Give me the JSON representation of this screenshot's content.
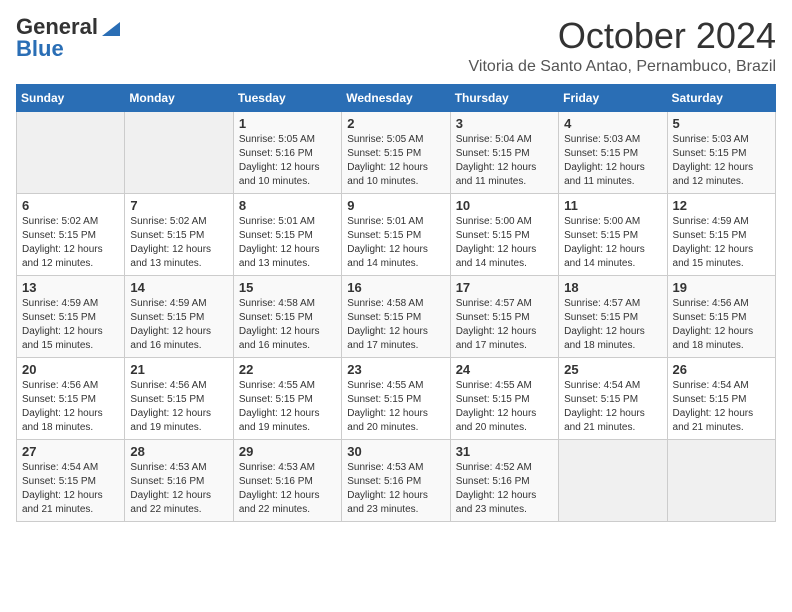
{
  "header": {
    "logo_general": "General",
    "logo_blue": "Blue",
    "month": "October 2024",
    "location": "Vitoria de Santo Antao, Pernambuco, Brazil"
  },
  "weekdays": [
    "Sunday",
    "Monday",
    "Tuesday",
    "Wednesday",
    "Thursday",
    "Friday",
    "Saturday"
  ],
  "weeks": [
    [
      {
        "day": null
      },
      {
        "day": null
      },
      {
        "day": "1",
        "sunrise": "5:05 AM",
        "sunset": "5:16 PM",
        "daylight": "12 hours and 10 minutes."
      },
      {
        "day": "2",
        "sunrise": "5:05 AM",
        "sunset": "5:15 PM",
        "daylight": "12 hours and 10 minutes."
      },
      {
        "day": "3",
        "sunrise": "5:04 AM",
        "sunset": "5:15 PM",
        "daylight": "12 hours and 11 minutes."
      },
      {
        "day": "4",
        "sunrise": "5:03 AM",
        "sunset": "5:15 PM",
        "daylight": "12 hours and 11 minutes."
      },
      {
        "day": "5",
        "sunrise": "5:03 AM",
        "sunset": "5:15 PM",
        "daylight": "12 hours and 12 minutes."
      }
    ],
    [
      {
        "day": "6",
        "sunrise": "5:02 AM",
        "sunset": "5:15 PM",
        "daylight": "12 hours and 12 minutes."
      },
      {
        "day": "7",
        "sunrise": "5:02 AM",
        "sunset": "5:15 PM",
        "daylight": "12 hours and 13 minutes."
      },
      {
        "day": "8",
        "sunrise": "5:01 AM",
        "sunset": "5:15 PM",
        "daylight": "12 hours and 13 minutes."
      },
      {
        "day": "9",
        "sunrise": "5:01 AM",
        "sunset": "5:15 PM",
        "daylight": "12 hours and 14 minutes."
      },
      {
        "day": "10",
        "sunrise": "5:00 AM",
        "sunset": "5:15 PM",
        "daylight": "12 hours and 14 minutes."
      },
      {
        "day": "11",
        "sunrise": "5:00 AM",
        "sunset": "5:15 PM",
        "daylight": "12 hours and 14 minutes."
      },
      {
        "day": "12",
        "sunrise": "4:59 AM",
        "sunset": "5:15 PM",
        "daylight": "12 hours and 15 minutes."
      }
    ],
    [
      {
        "day": "13",
        "sunrise": "4:59 AM",
        "sunset": "5:15 PM",
        "daylight": "12 hours and 15 minutes."
      },
      {
        "day": "14",
        "sunrise": "4:59 AM",
        "sunset": "5:15 PM",
        "daylight": "12 hours and 16 minutes."
      },
      {
        "day": "15",
        "sunrise": "4:58 AM",
        "sunset": "5:15 PM",
        "daylight": "12 hours and 16 minutes."
      },
      {
        "day": "16",
        "sunrise": "4:58 AM",
        "sunset": "5:15 PM",
        "daylight": "12 hours and 17 minutes."
      },
      {
        "day": "17",
        "sunrise": "4:57 AM",
        "sunset": "5:15 PM",
        "daylight": "12 hours and 17 minutes."
      },
      {
        "day": "18",
        "sunrise": "4:57 AM",
        "sunset": "5:15 PM",
        "daylight": "12 hours and 18 minutes."
      },
      {
        "day": "19",
        "sunrise": "4:56 AM",
        "sunset": "5:15 PM",
        "daylight": "12 hours and 18 minutes."
      }
    ],
    [
      {
        "day": "20",
        "sunrise": "4:56 AM",
        "sunset": "5:15 PM",
        "daylight": "12 hours and 18 minutes."
      },
      {
        "day": "21",
        "sunrise": "4:56 AM",
        "sunset": "5:15 PM",
        "daylight": "12 hours and 19 minutes."
      },
      {
        "day": "22",
        "sunrise": "4:55 AM",
        "sunset": "5:15 PM",
        "daylight": "12 hours and 19 minutes."
      },
      {
        "day": "23",
        "sunrise": "4:55 AM",
        "sunset": "5:15 PM",
        "daylight": "12 hours and 20 minutes."
      },
      {
        "day": "24",
        "sunrise": "4:55 AM",
        "sunset": "5:15 PM",
        "daylight": "12 hours and 20 minutes."
      },
      {
        "day": "25",
        "sunrise": "4:54 AM",
        "sunset": "5:15 PM",
        "daylight": "12 hours and 21 minutes."
      },
      {
        "day": "26",
        "sunrise": "4:54 AM",
        "sunset": "5:15 PM",
        "daylight": "12 hours and 21 minutes."
      }
    ],
    [
      {
        "day": "27",
        "sunrise": "4:54 AM",
        "sunset": "5:15 PM",
        "daylight": "12 hours and 21 minutes."
      },
      {
        "day": "28",
        "sunrise": "4:53 AM",
        "sunset": "5:16 PM",
        "daylight": "12 hours and 22 minutes."
      },
      {
        "day": "29",
        "sunrise": "4:53 AM",
        "sunset": "5:16 PM",
        "daylight": "12 hours and 22 minutes."
      },
      {
        "day": "30",
        "sunrise": "4:53 AM",
        "sunset": "5:16 PM",
        "daylight": "12 hours and 23 minutes."
      },
      {
        "day": "31",
        "sunrise": "4:52 AM",
        "sunset": "5:16 PM",
        "daylight": "12 hours and 23 minutes."
      },
      {
        "day": null
      },
      {
        "day": null
      }
    ]
  ]
}
